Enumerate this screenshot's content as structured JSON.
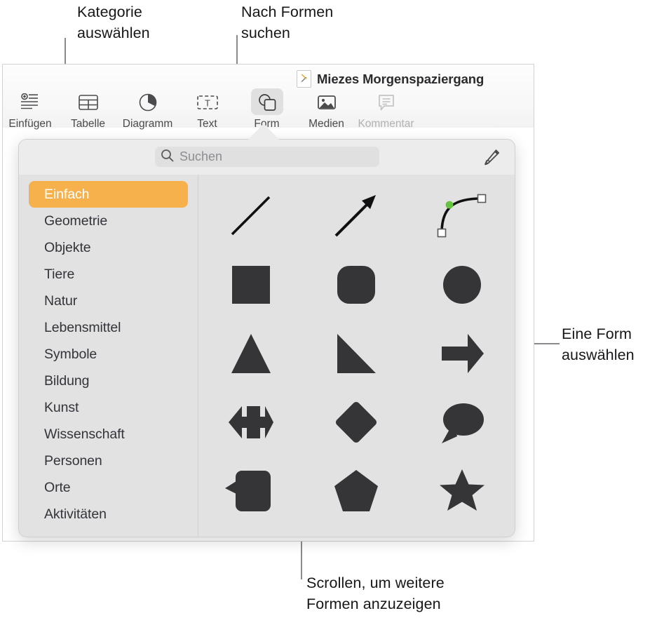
{
  "annotations": {
    "category": "Kategorie\nauswählen",
    "search": "Nach Formen\nsuchen",
    "pick_shape": "Eine Form\nauswählen",
    "scroll": "Scrollen, um weitere\nFormen anzuzeigen"
  },
  "window": {
    "document_title": "Miezes Morgenspaziergang",
    "document_icon": "document-pencil-icon"
  },
  "toolbar": {
    "items": [
      {
        "label": "Einfügen",
        "icon": "insert-icon",
        "active": false,
        "dim": false
      },
      {
        "label": "Tabelle",
        "icon": "table-icon",
        "active": false,
        "dim": false
      },
      {
        "label": "Diagramm",
        "icon": "chart-pie-icon",
        "active": false,
        "dim": false
      },
      {
        "label": "Text",
        "icon": "text-box-icon",
        "active": false,
        "dim": false
      },
      {
        "label": "Form",
        "icon": "shapes-icon",
        "active": true,
        "dim": false
      },
      {
        "label": "Medien",
        "icon": "media-image-icon",
        "active": false,
        "dim": false
      },
      {
        "label": "Kommentar",
        "icon": "comment-icon",
        "active": false,
        "dim": true
      }
    ]
  },
  "popover": {
    "search": {
      "placeholder": "Suchen",
      "value": "",
      "icon": "search-icon"
    },
    "draw_button_icon": "pen-draw-icon",
    "categories": [
      {
        "label": "Einfach",
        "selected": true
      },
      {
        "label": "Geometrie",
        "selected": false
      },
      {
        "label": "Objekte",
        "selected": false
      },
      {
        "label": "Tiere",
        "selected": false
      },
      {
        "label": "Natur",
        "selected": false
      },
      {
        "label": "Lebensmittel",
        "selected": false
      },
      {
        "label": "Symbole",
        "selected": false
      },
      {
        "label": "Bildung",
        "selected": false
      },
      {
        "label": "Kunst",
        "selected": false
      },
      {
        "label": "Wissenschaft",
        "selected": false
      },
      {
        "label": "Personen",
        "selected": false
      },
      {
        "label": "Orte",
        "selected": false
      },
      {
        "label": "Aktivitäten",
        "selected": false
      }
    ],
    "shapes": [
      {
        "name": "line-shape"
      },
      {
        "name": "arrow-line-shape"
      },
      {
        "name": "bezier-curve-shape"
      },
      {
        "name": "square-shape"
      },
      {
        "name": "rounded-square-shape"
      },
      {
        "name": "circle-shape"
      },
      {
        "name": "triangle-shape"
      },
      {
        "name": "right-triangle-shape"
      },
      {
        "name": "block-arrow-right-shape"
      },
      {
        "name": "double-arrow-shape"
      },
      {
        "name": "diamond-shape"
      },
      {
        "name": "speech-bubble-oval-shape"
      },
      {
        "name": "speech-bubble-rect-shape"
      },
      {
        "name": "pentagon-shape"
      },
      {
        "name": "star-shape"
      }
    ]
  },
  "colors": {
    "accent_selected": "#F7B14C",
    "shape_fill": "#353537",
    "popover_bg": "#E2E2E2",
    "curve_handle_green": "#66C241",
    "leader_line": "#8A8A8E"
  }
}
